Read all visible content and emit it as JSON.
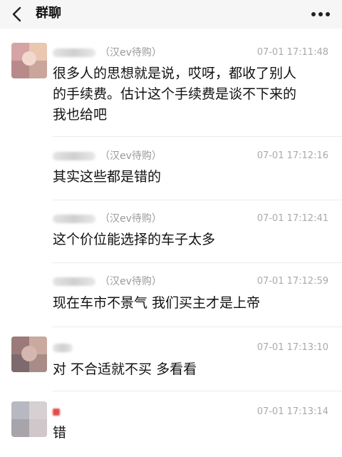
{
  "header": {
    "title": "群聊",
    "back_icon": "chevron-left-icon",
    "more_icon": "more-dots-icon"
  },
  "messages": [
    {
      "sender_tag": "（汉ev待购）",
      "time": "07-01 17:11:48",
      "text_lines": [
        "很多人的思想就是说，哎呀，都收了别人",
        "的手续费。估计这个手续费是谈不下来的",
        "我也给吧"
      ],
      "avatar_colors": [
        "#d6a4a4",
        "#b98a8a",
        "#e9c7b0"
      ]
    },
    {
      "sender_tag": "（汉ev待购）",
      "time": "07-01 17:12:16",
      "text_lines": [
        "其实这些都是错的"
      ]
    },
    {
      "sender_tag": "（汉ev待购）",
      "time": "07-01 17:12:41",
      "text_lines": [
        "这个价位能选择的车子太多"
      ]
    },
    {
      "sender_tag": "（汉ev待购）",
      "time": "07-01 17:12:59",
      "text_lines": [
        "现在车市不景气  我们买主才是上帝"
      ]
    },
    {
      "sender_tag": "",
      "time": "07-01 17:13:10",
      "text_lines": [
        "对 不合适就不买  多看看"
      ],
      "avatar_colors": [
        "#9c7a7a",
        "#c9a9a0",
        "#7d6a6e"
      ]
    },
    {
      "sender_tag": "",
      "time": "07-01 17:13:14",
      "text_lines": [
        "错"
      ],
      "avatar_colors": [
        "#b8b8c2",
        "#d6d0d2",
        "#a8a4ac"
      ]
    }
  ]
}
